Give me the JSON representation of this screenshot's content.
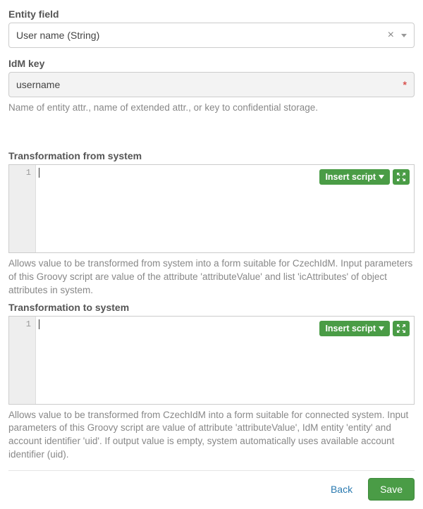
{
  "entityField": {
    "label": "Entity field",
    "value": "User name (String)"
  },
  "idmKey": {
    "label": "IdM key",
    "value": "username",
    "helper": "Name of entity attr., name of extended attr., or key to confidential storage."
  },
  "transformFrom": {
    "label": "Transformation from system",
    "insertLabel": "Insert script",
    "lineNumber": "1",
    "helper": "Allows value to be transformed from system into a form suitable for CzechIdM. Input parameters of this Groovy script are value of the attribute 'attributeValue' and list 'icAttributes' of object attributes in system."
  },
  "transformTo": {
    "label": "Transformation to system",
    "insertLabel": "Insert script",
    "lineNumber": "1",
    "helper": "Allows value to be transformed from CzechIdM into a form suitable for connected system. Input parameters of this Groovy script are value of attribute 'attributeValue', IdM entity 'entity' and account identifier 'uid'. If output value is empty, system automatically uses available account identifier (uid)."
  },
  "footer": {
    "back": "Back",
    "save": "Save"
  }
}
